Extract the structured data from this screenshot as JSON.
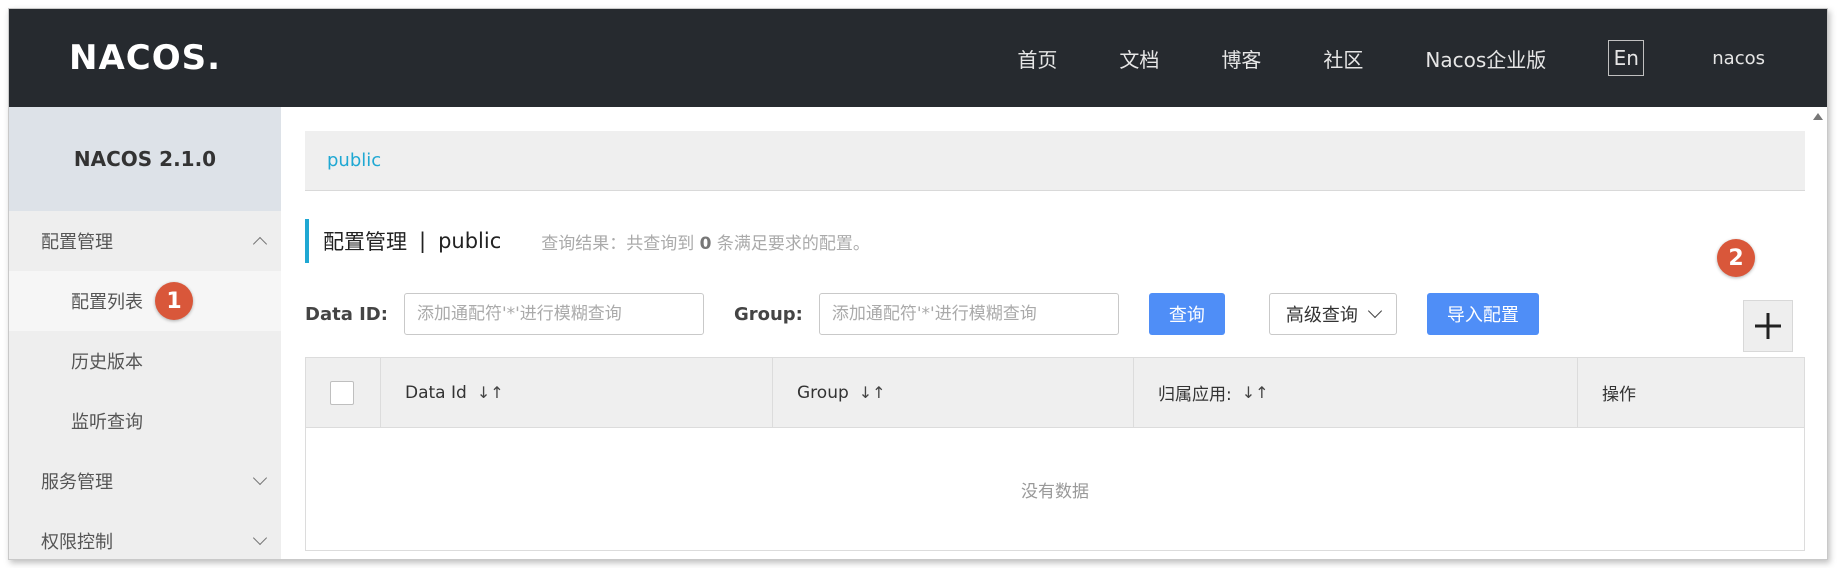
{
  "header": {
    "logo": "NACOS.",
    "nav": [
      {
        "label": "首页"
      },
      {
        "label": "文档"
      },
      {
        "label": "博客"
      },
      {
        "label": "社区"
      },
      {
        "label": "Nacos企业版"
      }
    ],
    "lang": "En",
    "user": "nacos"
  },
  "sidebar": {
    "title": "NACOS 2.1.0",
    "groups": [
      {
        "label": "配置管理",
        "items": [
          {
            "label": "配置列表",
            "active": true
          },
          {
            "label": "历史版本"
          },
          {
            "label": "监听查询"
          }
        ]
      },
      {
        "label": "服务管理"
      },
      {
        "label": "权限控制"
      }
    ]
  },
  "namespace": {
    "label": "public"
  },
  "page": {
    "title": "配置管理",
    "separator": "|",
    "namespace": "public",
    "result_prefix": "查询结果：共查询到",
    "result_count": "0",
    "result_suffix": "条满足要求的配置。"
  },
  "filters": {
    "dataid_label": "Data ID:",
    "dataid_placeholder": "添加通配符'*'进行模糊查询",
    "group_label": "Group:",
    "group_placeholder": "添加通配符'*'进行模糊查询",
    "query_label": "查询",
    "advanced_label": "高级查询",
    "import_label": "导入配置"
  },
  "table": {
    "columns": [
      "Data Id",
      "Group",
      "归属应用:",
      "操作"
    ],
    "empty": "没有数据"
  },
  "annotations": {
    "badge1": "1",
    "badge2": "2",
    "badge_color": "#d9573a"
  }
}
